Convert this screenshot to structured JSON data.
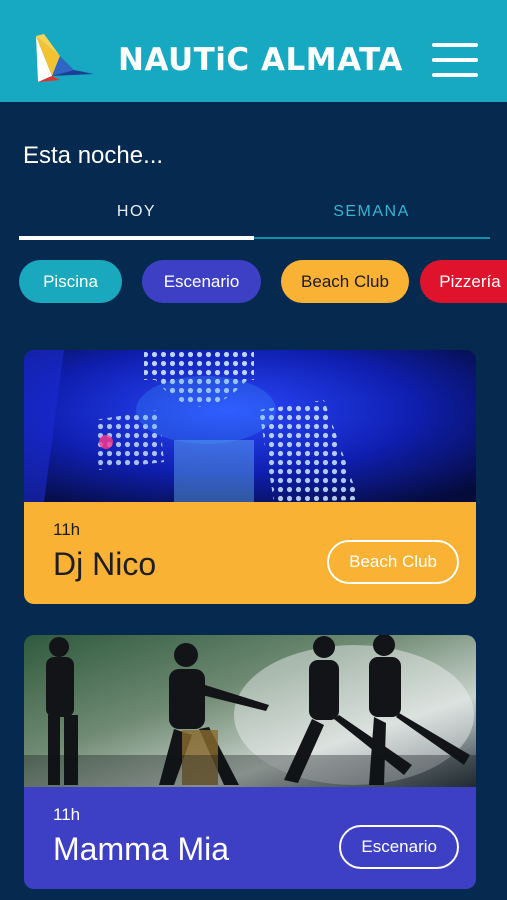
{
  "header": {
    "brand": "NAUTiC ALMATA"
  },
  "section": {
    "title": "Esta noche..."
  },
  "tabs": [
    {
      "label": "HOY",
      "active": true
    },
    {
      "label": "SEMANA",
      "active": false
    }
  ],
  "filters": [
    {
      "label": "Piscina",
      "color": "#19a8be"
    },
    {
      "label": "Escenario",
      "color": "#3d40c4"
    },
    {
      "label": "Beach Club",
      "color": "#f9b233"
    },
    {
      "label": "Pizzería",
      "color": "#e0132c"
    }
  ],
  "events": [
    {
      "time": "11h",
      "title": "Dj Nico",
      "venue": "Beach Club",
      "color": "#f9b233",
      "image": "led-robot-dancer-photo"
    },
    {
      "time": "11h",
      "title": "Mamma Mia",
      "venue": "Escenario",
      "color": "#3d40c4",
      "image": "group-dancers-photo"
    }
  ],
  "colors": {
    "header": "#17a9c1",
    "background": "#062a4f"
  }
}
